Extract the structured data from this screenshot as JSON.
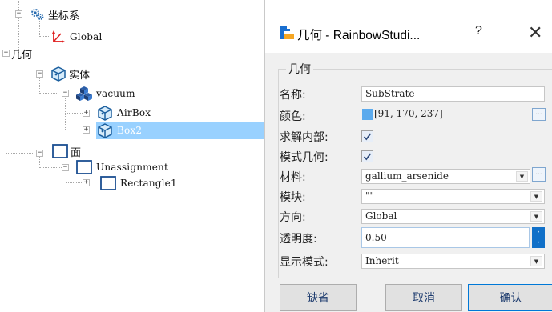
{
  "tree": {
    "coord_label": "坐标系",
    "global_label": "Global",
    "geometry_label": "几何",
    "solid_label": "实体",
    "vacuum_label": "vacuum",
    "airbox_label": "AirBox",
    "box2_label": "Box2",
    "face_label": "面",
    "unassignment_label": "Unassignment",
    "rectangle_label": "Rectangle1",
    "expand_minus": "−",
    "expand_plus": "+"
  },
  "dialog": {
    "title": "几何 - RainbowStudi...",
    "help_glyph": "?",
    "close_glyph": "✕",
    "group_title": "几何",
    "name_label": "名称:",
    "name_value": "SubStrate",
    "color_label": "颜色:",
    "color_value": "[91, 170, 237]",
    "color_swatch": "#5baaed",
    "color_browse": "...",
    "solve_inside_label": "求解内部:",
    "solve_inside_checked": true,
    "model_geom_label": "模式几何:",
    "model_geom_checked": true,
    "material_label": "材料:",
    "material_value": "gallium_arsenide",
    "material_browse": "...",
    "module_label": "模块:",
    "module_value": "\"\"",
    "direction_label": "方向:",
    "direction_value": "Global",
    "transparency_label": "透明度:",
    "transparency_value": "0.50",
    "display_mode_label": "显示模式:",
    "display_mode_value": "Inherit",
    "default_button": "缺省",
    "cancel_button": "取消",
    "ok_button": "确认"
  },
  "colors": {
    "selection": "#99d1ff",
    "accent_blue": "#1a6fd0",
    "spin_blue": "#1170c8"
  }
}
